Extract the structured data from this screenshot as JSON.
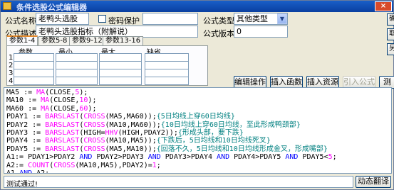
{
  "window": {
    "title": "条件选股公式编辑器",
    "close_label": "×"
  },
  "form": {
    "name_label": "公式名称",
    "name_value": "老鸭头选股",
    "password_label": "密码保护",
    "desc_label": "公式描述",
    "desc_value": "老鸭头选股指标（附解说）",
    "type_label": "公式类型",
    "type_value": "其他类型",
    "version_label": "公式版本",
    "version_value": "0"
  },
  "tabs": [
    {
      "label": "参数1-4"
    },
    {
      "label": "参数5-8"
    },
    {
      "label": "参数9-12"
    },
    {
      "label": "参数13-16"
    }
  ],
  "param_grid": {
    "headers": [
      "参数",
      "最小",
      "最大",
      "缺省"
    ],
    "rows": [
      "1",
      "2",
      "3",
      "4"
    ]
  },
  "buttons": {
    "edit_ops": "编辑操作",
    "insert_func": "插入函数",
    "insert_resource": "插入资源",
    "import_formula": "引入公式",
    "test_partial": "测",
    "dynamic_translate": "动态翻译"
  },
  "side_buttons": [
    "确",
    "取",
    "另"
  ],
  "code_lines": [
    [
      [
        "t",
        "MA5 := "
      ],
      [
        "fn",
        "MA"
      ],
      [
        "t",
        "(CLOSE,"
      ],
      [
        "num",
        "5"
      ],
      [
        "t",
        ");"
      ]
    ],
    [
      [
        "t",
        "MA10 := "
      ],
      [
        "fn",
        "MA"
      ],
      [
        "t",
        "(CLOSE,"
      ],
      [
        "num",
        "10"
      ],
      [
        "t",
        ");"
      ]
    ],
    [
      [
        "t",
        "MA60 := "
      ],
      [
        "fn",
        "MA"
      ],
      [
        "t",
        "(CLOSE,"
      ],
      [
        "num",
        "60"
      ],
      [
        "t",
        ");"
      ]
    ],
    [
      [
        "t",
        "PDAY1 := "
      ],
      [
        "fn",
        "BARSLAST"
      ],
      [
        "t",
        "("
      ],
      [
        "fn",
        "CROSS"
      ],
      [
        "t",
        "(MA5,MA60));"
      ],
      [
        "cm",
        "{5日均线上穿60日均线}"
      ]
    ],
    [
      [
        "t",
        "PDAY2 := "
      ],
      [
        "fn",
        "BARSLAST"
      ],
      [
        "t",
        "("
      ],
      [
        "fn",
        "CROSS"
      ],
      [
        "t",
        "(MA10,MA60));"
      ],
      [
        "cm",
        "{10日均线上穿60日均线，至此形成鸭颈部}"
      ]
    ],
    [
      [
        "t",
        "PDAY3 := "
      ],
      [
        "fn",
        "BARSLAST"
      ],
      [
        "t",
        "(HIGH="
      ],
      [
        "fn",
        "HHV"
      ],
      [
        "t",
        "(HIGH,PDAY2));"
      ],
      [
        "cm",
        "{形成头部，要下跌}"
      ]
    ],
    [
      [
        "t",
        "PDAY4 := "
      ],
      [
        "fn",
        "BARSLAST"
      ],
      [
        "t",
        "("
      ],
      [
        "fn",
        "CROSS"
      ],
      [
        "t",
        "(MA10,MA5));"
      ],
      [
        "cm",
        "{下跌后，5日均线和10日均线死叉}"
      ]
    ],
    [
      [
        "t",
        "PDAY5 := "
      ],
      [
        "fn",
        "BARSLAST"
      ],
      [
        "t",
        "("
      ],
      [
        "fn",
        "CROSS"
      ],
      [
        "t",
        "(MA5,MA10));"
      ],
      [
        "cm",
        "{回落不久，5日均线和10日均线形成金叉，形成嘴部}"
      ]
    ],
    [
      [
        "t",
        "A1:= PDAY1>PDAY2 "
      ],
      [
        "kw",
        "AND"
      ],
      [
        "t",
        " PDAY2>PDAY3 "
      ],
      [
        "kw",
        "AND"
      ],
      [
        "t",
        " PDAY3>PDAY4 "
      ],
      [
        "kw",
        "AND"
      ],
      [
        "t",
        " PDAY4>PDAY5 "
      ],
      [
        "kw",
        "AND"
      ],
      [
        "t",
        " PDAY5<"
      ],
      [
        "num",
        "5"
      ],
      [
        "t",
        ";"
      ]
    ],
    [
      [
        "t",
        "A2:= "
      ],
      [
        "fn",
        "COUNT"
      ],
      [
        "t",
        "("
      ],
      [
        "fn",
        "CROSS"
      ],
      [
        "t",
        "(MA10,MA5),PDAY2)="
      ],
      [
        "num",
        "1"
      ],
      [
        "t",
        ";"
      ]
    ],
    [
      [
        "t",
        "A1 "
      ],
      [
        "kw",
        "AND"
      ],
      [
        "t",
        " A2;"
      ]
    ]
  ],
  "status": {
    "text": "测试通过!"
  }
}
